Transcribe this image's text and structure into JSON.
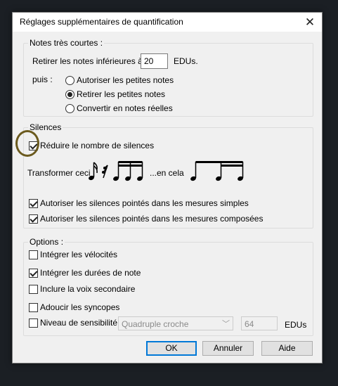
{
  "window": {
    "title": "Réglages supplémentaires de quantification",
    "close_glyph": "✕"
  },
  "short_notes": {
    "group_title": "Notes très courtes :",
    "remove_label": "Retirer les notes inférieures à",
    "threshold_value": "20",
    "unit": "EDUs.",
    "then_label": "puis :",
    "options": [
      {
        "label": "Autoriser les petites notes",
        "selected": false
      },
      {
        "label": "Retirer les petites notes",
        "selected": true
      },
      {
        "label": "Convertir en notes réelles",
        "selected": false
      }
    ]
  },
  "rests": {
    "group_title": "Silences",
    "reduce_label": "Réduire le nombre de silences",
    "reduce_checked": true,
    "transform_label": "Transformer ceci :",
    "into_label": "...en cela",
    "dotted_simple_label": "Autoriser les silences pointés dans les mesures simples",
    "dotted_simple_checked": true,
    "dotted_compound_label": "Autoriser les silences pointés dans les mesures composées",
    "dotted_compound_checked": true
  },
  "options": {
    "group_title": "Options :",
    "items": [
      {
        "label": "Intégrer les vélocités",
        "checked": false
      },
      {
        "label": "Intégrer les durées de note",
        "checked": true
      },
      {
        "label": "Inclure la voix secondaire",
        "checked": false
      },
      {
        "label": "Adoucir les syncopes",
        "checked": false
      }
    ],
    "sensitivity_label": "Niveau de sensibilité :",
    "sensitivity_checked": false,
    "sensitivity_select": "Quadruple croche",
    "sensitivity_value": "64",
    "sensitivity_unit": "EDUs"
  },
  "buttons": {
    "ok": "OK",
    "cancel": "Annuler",
    "help": "Aide"
  },
  "colors": {
    "accent": "#0078d7",
    "annotation": "#6b5a1e",
    "background": "#1b1f24"
  },
  "icons": {
    "close": "close-icon",
    "dropdown": "chevron-down-icon",
    "source_notation": "sixteenth-note-and-rest-icon",
    "target_notation": "eighth-and-sixteenth-notes-icon"
  }
}
